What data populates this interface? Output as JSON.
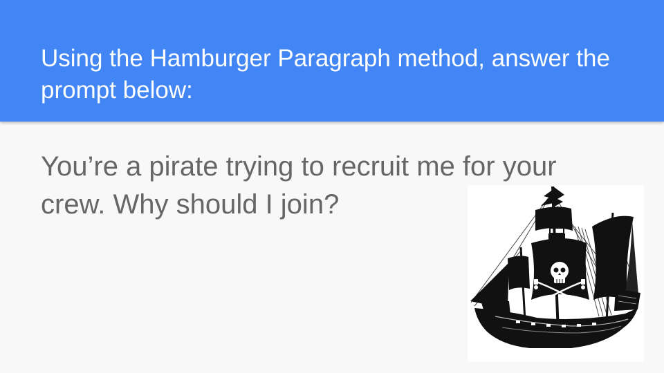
{
  "slide": {
    "title": "Using the Hamburger Paragraph method, answer the prompt below:",
    "body": "You’re a pirate trying to recruit me for your crew. Why should I join?"
  },
  "colors": {
    "header_background": "#4285f4",
    "title_text": "#ffffff",
    "body_text": "#666666",
    "slide_background": "#f8f8f8"
  },
  "illustration": {
    "icon": "pirate-ship-icon"
  }
}
